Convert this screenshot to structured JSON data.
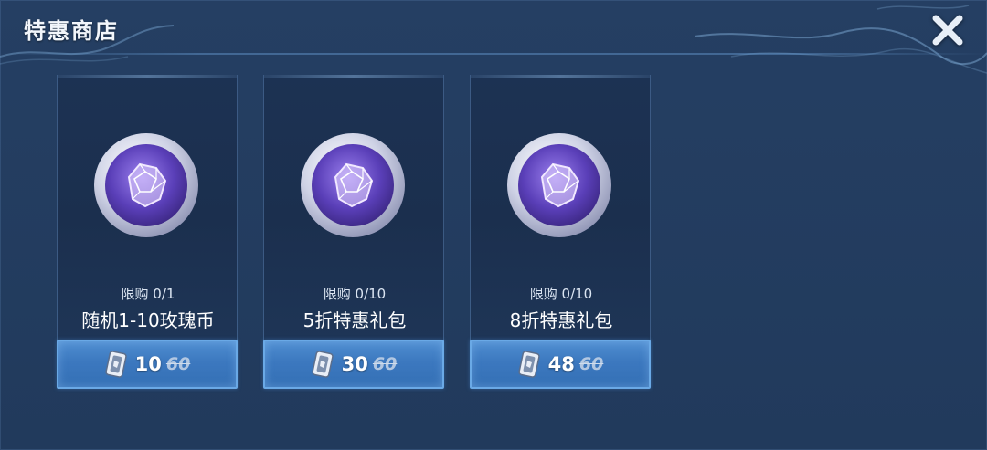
{
  "title": "特惠商店",
  "colors": {
    "panel": "#213a5c",
    "button": "#3c78bf",
    "button_border": "#6aa9e6",
    "coin_purple": "#6a4fc9"
  },
  "icons": {
    "close": "close-icon",
    "coin": "rose-coin-icon",
    "currency": "voucher-icon"
  },
  "items": [
    {
      "limit": "限购 0/1",
      "name": "随机1-10玫瑰币",
      "price": "10",
      "original_price": "60"
    },
    {
      "limit": "限购 0/10",
      "name": "5折特惠礼包",
      "price": "30",
      "original_price": "60"
    },
    {
      "limit": "限购 0/10",
      "name": "8折特惠礼包",
      "price": "48",
      "original_price": "60"
    }
  ]
}
